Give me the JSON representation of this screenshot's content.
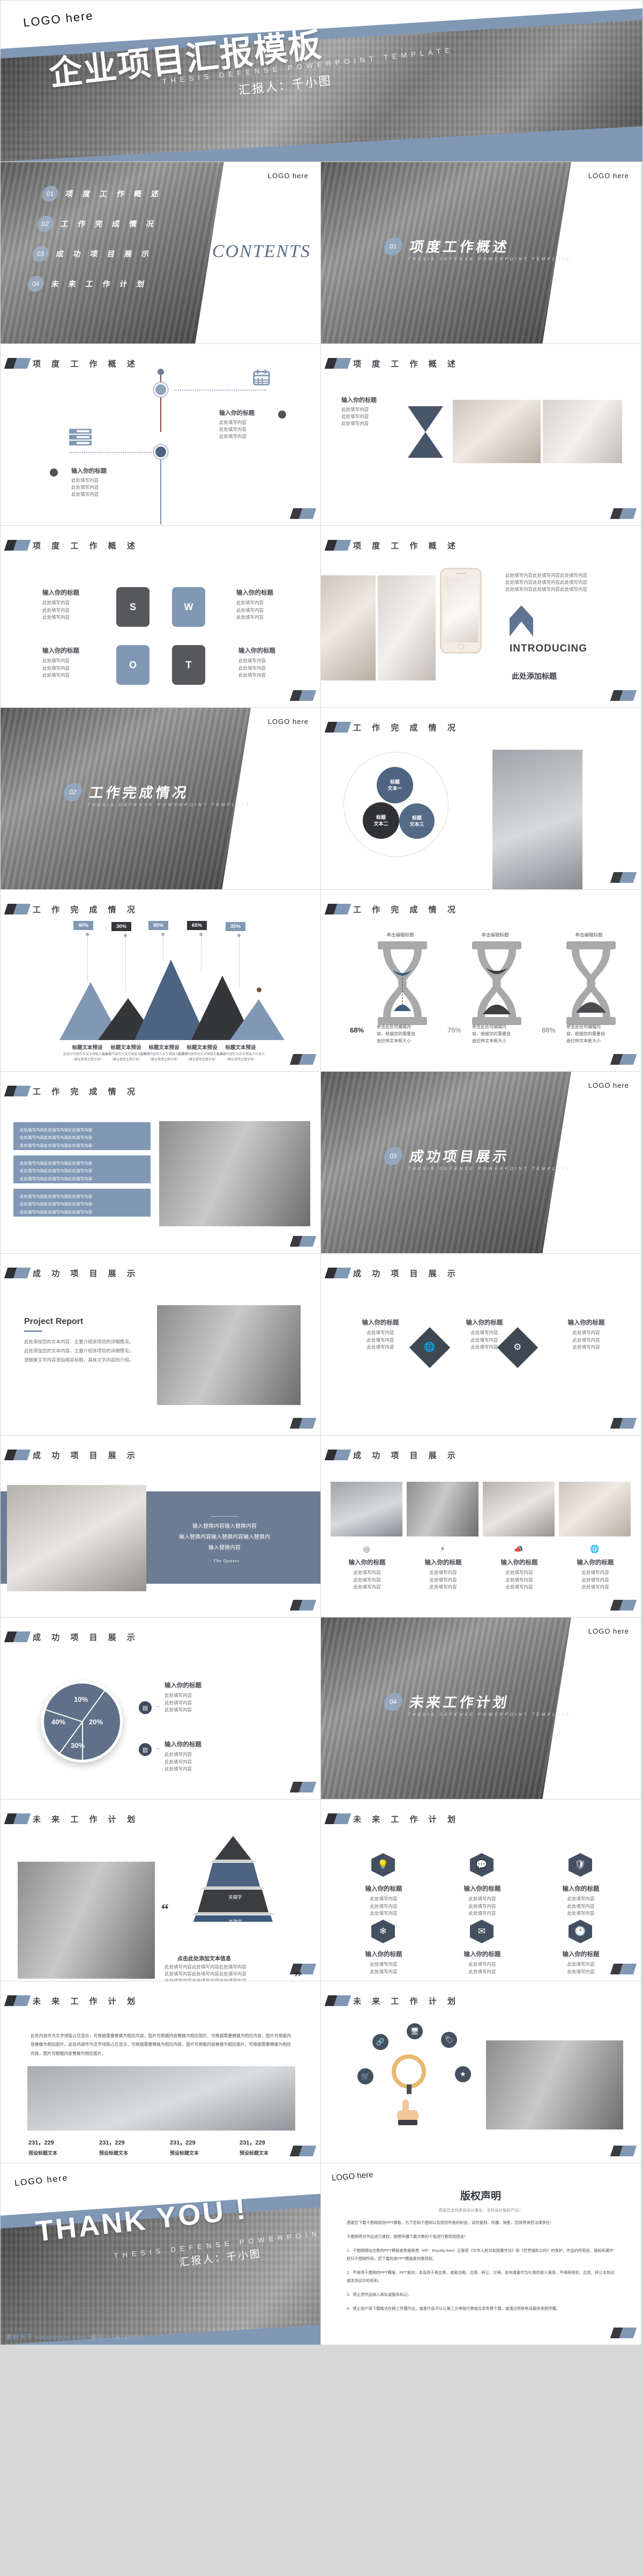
{
  "theme": {
    "blue": "#8198b5",
    "dark": "#3a3c40",
    "deep_blue": "#5f7088",
    "page_bg": "#d8d8d8"
  },
  "cover": {
    "logo": "LOGO here",
    "title": "企业项目汇报模板",
    "subtitle_en": "THESIS DEFENSE POWERPOINT TEMPLATE",
    "presenter": "汇报人：千小图"
  },
  "contents": {
    "logo": "LOGO here",
    "word": "CONTENTS",
    "items": [
      {
        "num": "01",
        "label": "项 度 工 作 概 述"
      },
      {
        "num": "02",
        "label": "工 作 完 成 情 况"
      },
      {
        "num": "03",
        "label": "成 功 项 目 展 示"
      },
      {
        "num": "04",
        "label": "未 来 工 作 计 划"
      }
    ]
  },
  "dividers": [
    {
      "logo": "LOGO here",
      "num": "01",
      "title": "项度工作概述",
      "en": "THESIS DEFENSE POWERPOINT TEMPLATE"
    },
    {
      "logo": "LOGO here",
      "num": "02",
      "title": "工作完成情况",
      "en": "THESIS DEFENSE POWERPOINT TEMPLATE"
    },
    {
      "logo": "LOGO here",
      "num": "03",
      "title": "成功项目展示",
      "en": "THESIS DEFENSE POWERPOINT TEMPLATE"
    },
    {
      "logo": "LOGO here",
      "num": "04",
      "title": "未来工作计划",
      "en": "THESIS DEFENSE POWERPOINT TEMPLATE"
    }
  ],
  "section_titles": {
    "s1": "项 度 工 作 概 述",
    "s2": "工 作 完 成 情 况",
    "s3": "成 功 项 目 展 示",
    "s4": "未 来 工 作 计 划"
  },
  "placeholders": {
    "title": "输入你的标题",
    "line": "此处填写内容",
    "add_title": "此处添加标题",
    "body_long": "此处填写内容此处填写内容此处填写内容",
    "click_edit_title": "单击编辑标题",
    "click_edit_body": "单击此处可编辑内容，根据您的需要自由拉伸文本框大小",
    "preset_title": "标题文本预设",
    "preset_body": "此部分内容作为文字排版占位显示",
    "preset_hint": "（建议使用主题字体）",
    "keyword": "关键字",
    "click_add_text": "点击此处添加文本信息",
    "replace": "输入替换内容输入替换内容",
    "replace2": "输入替换内容输入替换内容输入替换内",
    "replace3": "输入替换内容",
    "quotes": "- The Quotes",
    "preset_label": "预设标题文本",
    "stat_value": "231，229",
    "body_para": "此处内容作为文字排版占位显示，可根据需要替换为相应内容，图片可根据内容替换为相应图片。可根据需要替换为相应内容，图片可根据内容替换为相应图片。此处内容作为文字排版占位显示，可根据需要替换为相应内容，图片可根据内容替换为相应图片。可根据需要替换为相应内容，图片可根据内容替换为相应图片。",
    "introducing": "INTRODUCING",
    "venn": [
      "标题\n文本一",
      "标题\n文本二",
      "标题\n文本三"
    ]
  },
  "project_report": {
    "title": "Project Report",
    "body": "此处添加您的文本内容、主要介绍该项目的详细情况。此处添加您的文本内容、主要介绍该项目的详细情况，请替换文字内容添加相关标题，具体文字内容的介绍。"
  },
  "thank_you": {
    "logo": "LOGO here",
    "title": "THANK YOU !",
    "subtitle_en": "THESIS DEFENSE POWERPOINT TEMPLATE",
    "presenter": "汇报人：千小图"
  },
  "watermark": {
    "site": "素材天下 sucaisucai.com",
    "code": "编号： 06715705"
  },
  "copyright": {
    "logo": "LOGO here",
    "title": "版权声明",
    "subtitle": "感谢您支持原创设计事业，支持设计版权产品！",
    "paragraphs": [
      "感谢您下载千图网原创PPT模板，为了您和千图网以及原创作者的利益，请勿复制、传播、销售，否则将承担法律责任！",
      "千图网将对作品进行维权，按照传播下载次数的十倍进行索取赔偿金！",
      "1、千图网网站出售的PPT模版是免版税类（RF：Royalty-free）正版受《中华人民共和国著作法》和《世界版权公约》的保护，作品的所有权、版权和著作权归千图网所有，您下载的是PPT模版素材使用权。",
      "2、不得将千图网的PPT模版、PPT素材，本身用于再出售，或者出租、出借、转让、分销、发布或者作为礼物供他人使用，不得转授权、出卖、转让本协议或本协议中的权利。",
      "3、禁止把作品纳入商标或服务标记。",
      "4、禁止用户用下载格式在网上传播作品，或者作品可以让第三方单独付费或共享免费下载，或通过转移电话服务系统传播。"
    ]
  },
  "chart_data": [
    {
      "type": "area",
      "title": "工 作 完 成 情 况",
      "categories": [
        "标题文本预设",
        "标题文本预设",
        "标题文本预设",
        "标题文本预设",
        "标题文本预设"
      ],
      "values": [
        40,
        30,
        85,
        65,
        35
      ],
      "value_labels": [
        "40%",
        "30%",
        "85%",
        "65%",
        "35%"
      ],
      "colors": [
        "#8198b5",
        "#34363a",
        "#4f6party",
        "#34363a",
        "#8198b5"
      ],
      "ylim": [
        0,
        100
      ],
      "xlabel": "",
      "ylabel": ""
    },
    {
      "type": "bar",
      "title": "工 作 完 成 情 况",
      "categories": [
        "单击编辑标题",
        "单击编辑标题",
        "单击编辑标题"
      ],
      "values": [
        68,
        75,
        88
      ],
      "value_labels": [
        "68%",
        "75%",
        "88%"
      ],
      "ylim": [
        0,
        100
      ]
    },
    {
      "type": "pie",
      "title": "成 功 项 目 展 示",
      "categories": [
        "10%",
        "20%",
        "30%",
        "40%"
      ],
      "values": [
        10,
        20,
        30,
        40
      ],
      "colors": [
        "#5f7088",
        "#5f7088",
        "#5f7088",
        "#5f7088"
      ]
    },
    {
      "type": "bar",
      "title": "未 来 工 作 计 划",
      "categories": [
        "预设标题文本",
        "预设标题文本",
        "预设标题文本",
        "预设标题文本"
      ],
      "values": [
        231229,
        231229,
        231229,
        231229
      ],
      "value_labels": [
        "231，229",
        "231，229",
        "231，229",
        "231，229"
      ]
    }
  ]
}
